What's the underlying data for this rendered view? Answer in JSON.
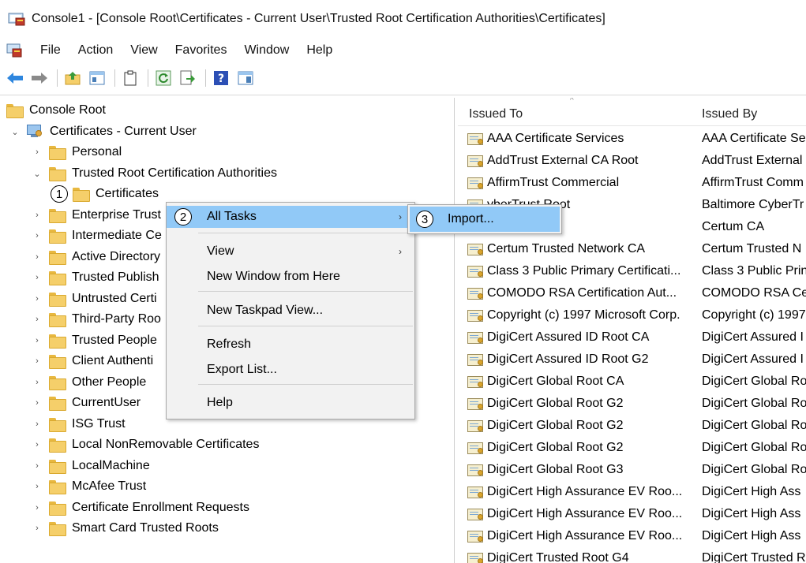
{
  "window": {
    "title": "Console1 - [Console Root\\Certificates - Current User\\Trusted Root Certification Authorities\\Certificates]"
  },
  "menu": [
    "File",
    "Action",
    "View",
    "Favorites",
    "Window",
    "Help"
  ],
  "toolbar": {
    "icons": [
      "back-arrow-icon",
      "forward-arrow-icon",
      "up-folder-icon",
      "show-hide-tree-icon",
      "clipboard-icon",
      "refresh-icon",
      "export-list-icon",
      "help-icon",
      "action-pane-icon"
    ]
  },
  "tree": {
    "root": "Console Root",
    "store": "Certificates - Current User",
    "items": [
      {
        "label": "Personal",
        "expanded": false
      },
      {
        "label": "Trusted Root Certification Authorities",
        "expanded": true
      },
      {
        "label": "Certificates",
        "child": true
      },
      {
        "label": "Enterprise Trust"
      },
      {
        "label": "Intermediate Certification Authorities"
      },
      {
        "label": "Active Directory User Object"
      },
      {
        "label": "Trusted Publishers"
      },
      {
        "label": "Untrusted Certificates"
      },
      {
        "label": "Third-Party Root Certification Authorities"
      },
      {
        "label": "Trusted People"
      },
      {
        "label": "Client Authentication Issuers"
      },
      {
        "label": "Other People"
      },
      {
        "label": "CurrentUser"
      },
      {
        "label": "ISG Trust"
      },
      {
        "label": "Local NonRemovable Certificates"
      },
      {
        "label": "LocalMachine"
      },
      {
        "label": "McAfee Trust"
      },
      {
        "label": "Certificate Enrollment Requests"
      },
      {
        "label": "Smart Card Trusted Roots"
      }
    ]
  },
  "tree_visible": {
    "personal": "Personal",
    "trusted_root": "Trusted Root Certification Authorities",
    "certificates": "Certificates",
    "enterprise": "Enterprise Trust",
    "intermediate": "Intermediate Ce",
    "active_directory": "Active Directory",
    "trusted_publish": "Trusted Publish",
    "untrusted": "Untrusted Certi",
    "third_party": "Third-Party Roo",
    "trusted_people": "Trusted People",
    "client_auth": "Client Authenti",
    "other_people": "Other People",
    "current_user": "CurrentUser",
    "isg": "ISG Trust",
    "local_nonremovable": "Local NonRemovable Certificates",
    "local_machine": "LocalMachine",
    "mcafee": "McAfee Trust",
    "enrollment": "Certificate Enrollment Requests",
    "smart_card": "Smart Card Trusted Roots"
  },
  "list": {
    "columns": [
      "Issued To",
      "Issued By"
    ],
    "rows": [
      {
        "issued_to": "AAA Certificate Services",
        "issued_by": "AAA Certificate Se"
      },
      {
        "issued_to": "AddTrust External CA Root",
        "issued_by": "AddTrust External"
      },
      {
        "issued_to": "AffirmTrust Commercial",
        "issued_by": "AffirmTrust Comm"
      },
      {
        "issued_to": "yberTrust Root",
        "issued_by": "Baltimore CyberTr"
      },
      {
        "issued_to": "",
        "issued_by": "Certum CA"
      },
      {
        "issued_to": "Certum Trusted Network CA",
        "issued_by": "Certum Trusted N"
      },
      {
        "issued_to": "Class 3 Public Primary Certificati...",
        "issued_by": "Class 3 Public Prin"
      },
      {
        "issued_to": "COMODO RSA Certification Aut...",
        "issued_by": "COMODO RSA Ce"
      },
      {
        "issued_to": "Copyright (c) 1997 Microsoft Corp.",
        "issued_by": "Copyright (c) 1997"
      },
      {
        "issued_to": "DigiCert Assured ID Root CA",
        "issued_by": "DigiCert Assured I"
      },
      {
        "issued_to": "DigiCert Assured ID Root G2",
        "issued_by": "DigiCert Assured I"
      },
      {
        "issued_to": "DigiCert Global Root CA",
        "issued_by": "DigiCert Global Ro"
      },
      {
        "issued_to": "DigiCert Global Root G2",
        "issued_by": "DigiCert Global Ro"
      },
      {
        "issued_to": "DigiCert Global Root G2",
        "issued_by": "DigiCert Global Ro"
      },
      {
        "issued_to": "DigiCert Global Root G2",
        "issued_by": "DigiCert Global Ro"
      },
      {
        "issued_to": "DigiCert Global Root G3",
        "issued_by": "DigiCert Global Ro"
      },
      {
        "issued_to": "DigiCert High Assurance EV Roo...",
        "issued_by": "DigiCert High Ass"
      },
      {
        "issued_to": "DigiCert High Assurance EV Roo...",
        "issued_by": "DigiCert High Ass"
      },
      {
        "issued_to": "DigiCert High Assurance EV Roo...",
        "issued_by": "DigiCert High Ass"
      },
      {
        "issued_to": "DigiCert Trusted Root G4",
        "issued_by": "DigiCert Trusted R"
      }
    ]
  },
  "context_menu": {
    "all_tasks": "All Tasks",
    "view": "View",
    "new_window": "New Window from Here",
    "new_taskpad": "New Taskpad View...",
    "refresh": "Refresh",
    "export": "Export List...",
    "help": "Help",
    "submenu_chevron": "›"
  },
  "submenu": {
    "import": "Import..."
  },
  "callouts": {
    "one": "1",
    "two": "2",
    "three": "3"
  },
  "colors": {
    "highlight": "#91c9f7",
    "menu_bg": "#f2f2f2"
  }
}
